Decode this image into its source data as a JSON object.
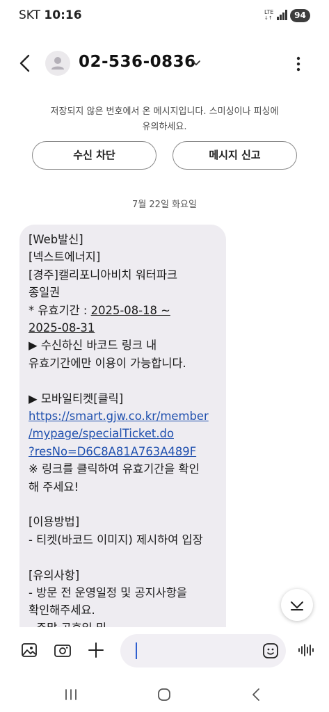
{
  "status": {
    "carrier": "SKT",
    "time": "10:16",
    "network": "LTE",
    "battery": "94"
  },
  "header": {
    "phone_number": "02-536-0836",
    "back_icon": "back-arrow-icon",
    "more_icon": "more-vert-icon"
  },
  "warning": {
    "line1": "저장되지 않은 번호에서 온 메시지입니다. 스미싱이나 피싱에",
    "line2": "유의하세요."
  },
  "actions": {
    "block_label": "수신 차단",
    "report_label": "메시지 신고"
  },
  "date_divider": "7월 22일 화요일",
  "message": {
    "lines": [
      "[Web발신]",
      "[넥스트에너지]",
      "[경주]캘리포니아비치 워터파크",
      "종일권",
      "* 유효기간 : ",
      "2025-08-18 ~",
      "2025-08-31",
      "▶ 수신하신 바코드 링크 내",
      "유효기간에만 이용이 가능합니다.",
      "",
      "▶ 모바일티켓[클릭]",
      "https://smart.gjw.co.kr/member",
      "/mypage/specialTicket.do",
      "?resNo=D6C8A81A763A489F",
      "※ 링크를 클릭하여 유효기간을 확인",
      "해 주세요!",
      "",
      "[이용방법]",
      "- 티켓(바코드 이미지) 제시하여 입장",
      "",
      "[유의사항]",
      "- 방문 전 운영일정 및 공지사항을",
      "확인해주세요.",
      "- 주말·공휴일 및"
    ]
  },
  "colors": {
    "bubble": "#eeecf1",
    "link": "#1e4fae",
    "caret": "#2f5fcf"
  }
}
